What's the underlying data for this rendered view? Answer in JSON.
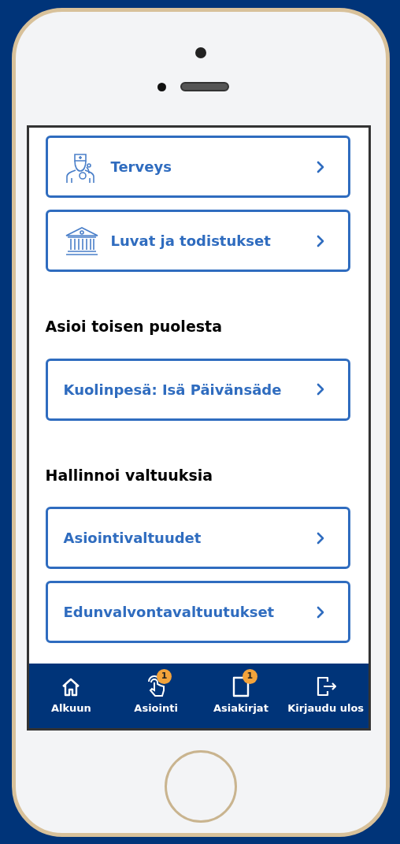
{
  "sections": [
    {
      "items": [
        {
          "label": "Terveys",
          "kind": "doctor"
        },
        {
          "label": "Luvat ja todistukset",
          "kind": "building"
        }
      ]
    },
    {
      "heading": "Asioi toisen puolesta",
      "items": [
        {
          "label": "Kuolinpesä: Isä Päivänsäde",
          "kind": "plain"
        }
      ]
    },
    {
      "heading": "Hallinnoi valtuuksia",
      "items": [
        {
          "label": "Asiointivaltuudet",
          "kind": "plain"
        },
        {
          "label": "Edunvalvontavaltuutukset",
          "kind": "plain"
        }
      ]
    }
  ],
  "bottom_nav": [
    {
      "label": "Alkuun",
      "kind": "home"
    },
    {
      "label": "Asiointi",
      "kind": "touch",
      "badge": "1"
    },
    {
      "label": "Asiakirjat",
      "kind": "document",
      "badge": "1"
    },
    {
      "label": "Kirjaudu ulos",
      "kind": "logout"
    }
  ]
}
